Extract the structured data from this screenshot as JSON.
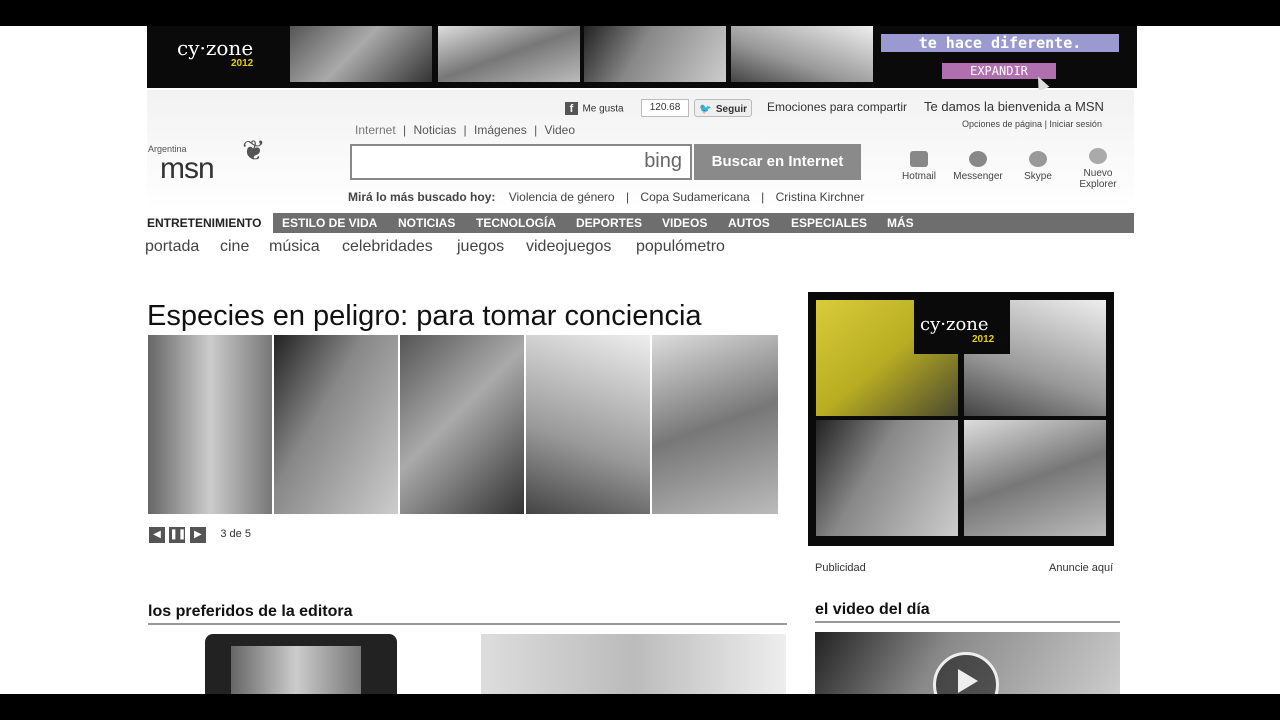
{
  "banner": {
    "brand": "cy·zone",
    "brand_year": "2012",
    "tagline": "te hace diferente.",
    "expand_label": "EXPANDIR"
  },
  "social": {
    "like_label": "Me gusta",
    "like_count": "120.68",
    "follow_label": "Seguir",
    "slogan": "Emociones para compartir",
    "welcome": "Te damos la bienvenida a MSN",
    "page_options": "Opciones de página",
    "sign_in": "Iniciar sesión"
  },
  "logo": {
    "region": "Argentina",
    "text": "msn"
  },
  "search": {
    "scopes": [
      "Internet",
      "Noticias",
      "Imágenes",
      "Video"
    ],
    "bing_label": "bing",
    "button_label": "Buscar en Internet",
    "trending_label": "Mirá lo más buscado hoy:",
    "trending": [
      "Violencia de género",
      "Copa Sudamericana",
      "Cristina Kirchner"
    ]
  },
  "apps": [
    {
      "label": "Hotmail",
      "icon": "mail-icon"
    },
    {
      "label": "Messenger",
      "icon": "messenger-icon"
    },
    {
      "label": "Skype",
      "icon": "skype-icon"
    },
    {
      "label": "Nuevo Explorer",
      "icon": "internet-explorer-icon"
    }
  ],
  "nav": {
    "active": "ENTRETENIMIENTO",
    "items": [
      "ESTILO DE VIDA",
      "NOTICIAS",
      "TECNOLOGÍA",
      "DEPORTES",
      "VIDEOS",
      "AUTOS",
      "ESPECIALES",
      "MÁS"
    ]
  },
  "subnav": [
    "portada",
    "cine",
    "música",
    "celebridades",
    "juegos",
    "videojuegos",
    "populómetro"
  ],
  "feature": {
    "title": "Especies en peligro: para tomar conciencia",
    "counter": "3 de 5"
  },
  "ad": {
    "left_label": "Publicidad",
    "right_label": "Anuncie aquí"
  },
  "sections": {
    "editor": "los preferidos de la editora",
    "video": "el video del día"
  },
  "colors": {
    "nav_bg": "#6e6e6e",
    "button_bg": "#8a8a8a",
    "expand_bg": "#b070b0"
  }
}
